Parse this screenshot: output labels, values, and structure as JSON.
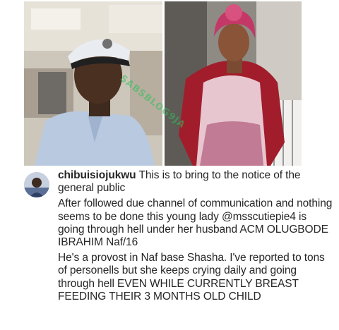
{
  "watermark": "SABSBLOG9JA",
  "comment": {
    "username": "chibuisiojukwu",
    "intro": " This is to bring to the notice of the general public",
    "paragraph1_before": "After followed due channel of communication and nothing seems to be done this young lady ",
    "mention": "@msscutiepie4",
    "paragraph1_after": " is going through hell under her husband ACM OLUGBODE IBRAHIM Naf/16",
    "paragraph2": "He's a provost in Naf base Shasha. I've reported to tons of personells but she keeps crying daily and going through hell EVEN WHILE CURRENTLY BREAST FEEDING THEIR 3 MONTHS OLD CHILD"
  },
  "colors": {
    "text": "#262626",
    "background": "#ffffff",
    "watermark": "#32be5a"
  }
}
